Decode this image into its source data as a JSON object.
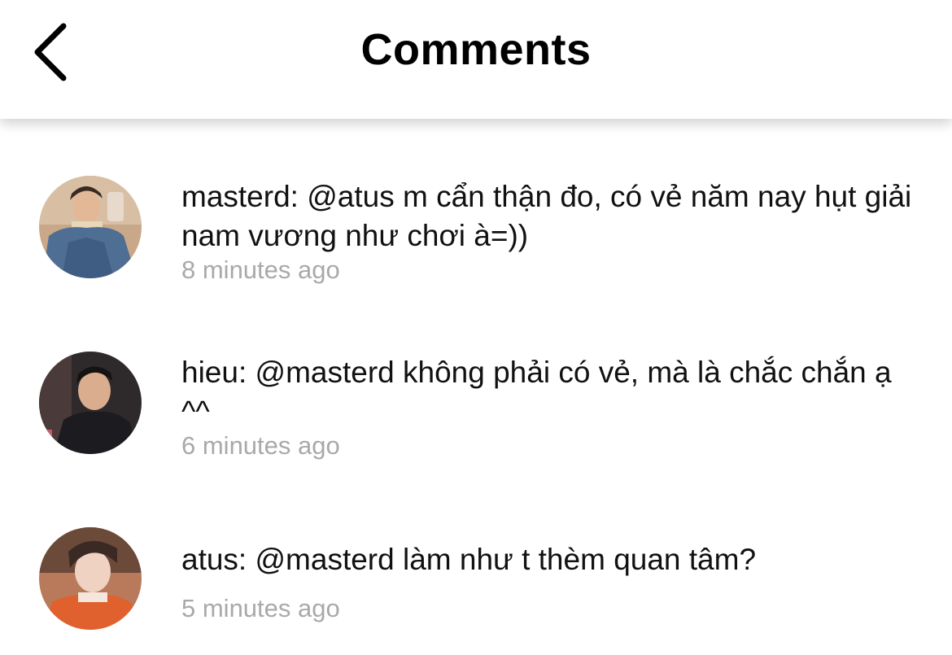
{
  "header": {
    "title": "Comments",
    "back_icon": "chevron-left-icon"
  },
  "comments": [
    {
      "username": "masterd",
      "text": "masterd: @atus m cẩn thận đo, có vẻ năm nay hụt giải nam vương như chơi à=))",
      "time": "8 minutes ago"
    },
    {
      "username": "hieu",
      "text": "hieu: @masterd không phải có vẻ, mà là chắc chắn ạ ^^",
      "time": "6 minutes ago"
    },
    {
      "username": "atus",
      "text": "atus: @masterd làm như t thèm quan tâm?",
      "time": "5 minutes ago"
    }
  ],
  "colors": {
    "text": "#111111",
    "timestamp": "#a9a9a9",
    "background": "#ffffff"
  }
}
